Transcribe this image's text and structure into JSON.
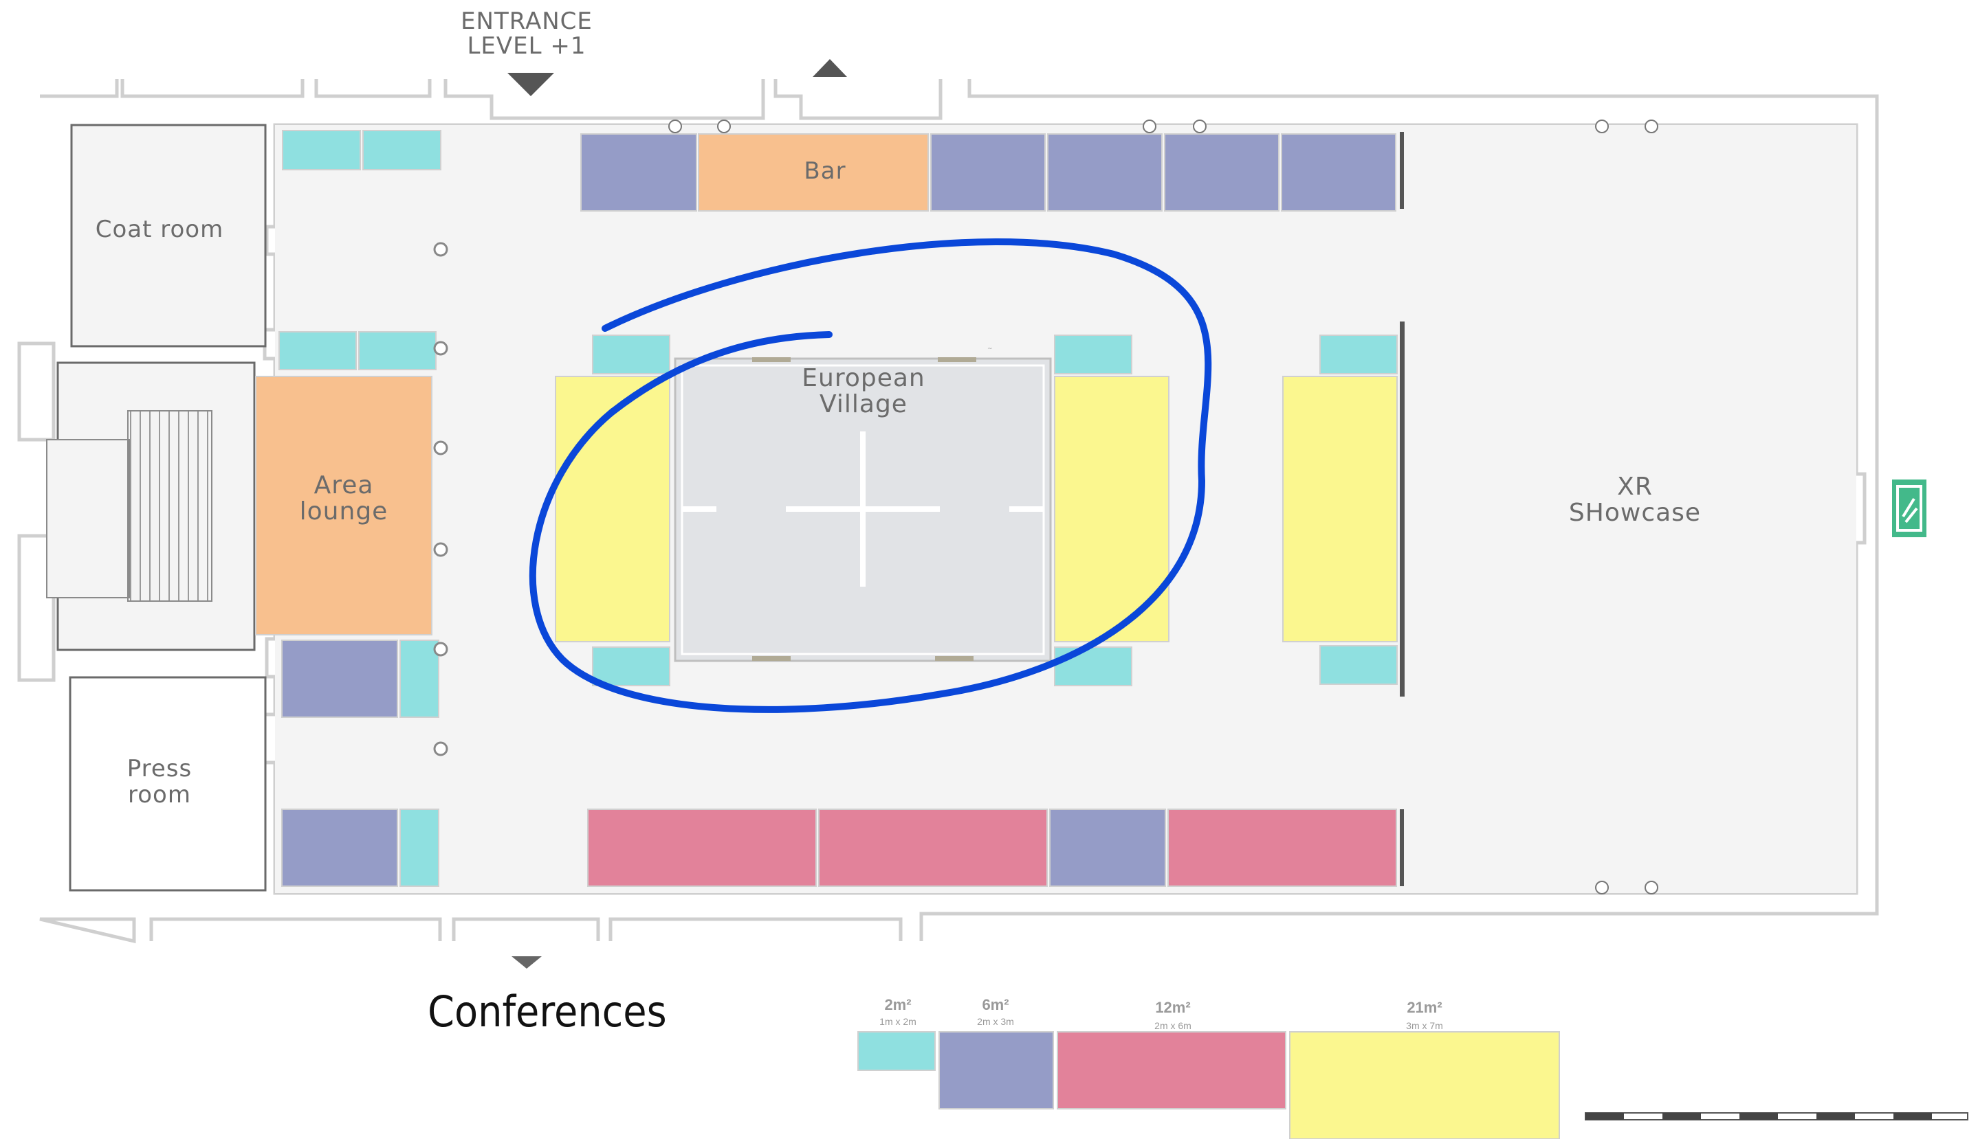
{
  "entrance_label_line1": "ENTRANCE",
  "entrance_label_line2": "LEVEL +1",
  "rooms": {
    "coat_room": "Coat room",
    "press_room_line1": "Press",
    "press_room_line2": "room",
    "bar": "Bar",
    "area_lounge_line1": "Area",
    "area_lounge_line2": "lounge",
    "european_village_line1": "European",
    "european_village_line2": "Village",
    "xr_showcase_line1": "XR",
    "xr_showcase_line2": "SHowcase"
  },
  "conferences_label": "Conferences",
  "legend": [
    {
      "area": "2m²",
      "dims": "1m x 2m",
      "color": "#8fe0e0"
    },
    {
      "area": "6m²",
      "dims": "2m x 3m",
      "color": "#959cc7"
    },
    {
      "area": "12m²",
      "dims": "2m x 6m",
      "color": "#e2829a"
    },
    {
      "area": "21m²",
      "dims": "3m x 7m",
      "color": "#fbf78f"
    }
  ],
  "colors": {
    "stand_2m2": "#8fe0e0",
    "stand_6m2": "#959cc7",
    "stand_12m2": "#e2829a",
    "stand_21m2": "#fbf78f",
    "lounge_bar": "#f8c08e",
    "village_floor": "#e1e3e6",
    "hall_floor": "#f4f4f4",
    "highlight_ellipse": "#0a47d9",
    "exit_sign": "#43b98a"
  },
  "icons": [
    "entrance-down-arrow-icon",
    "up-arrow-icon",
    "conference-down-arrow-icon",
    "emergency-exit-icon",
    "door-icon",
    "column-icon"
  ]
}
